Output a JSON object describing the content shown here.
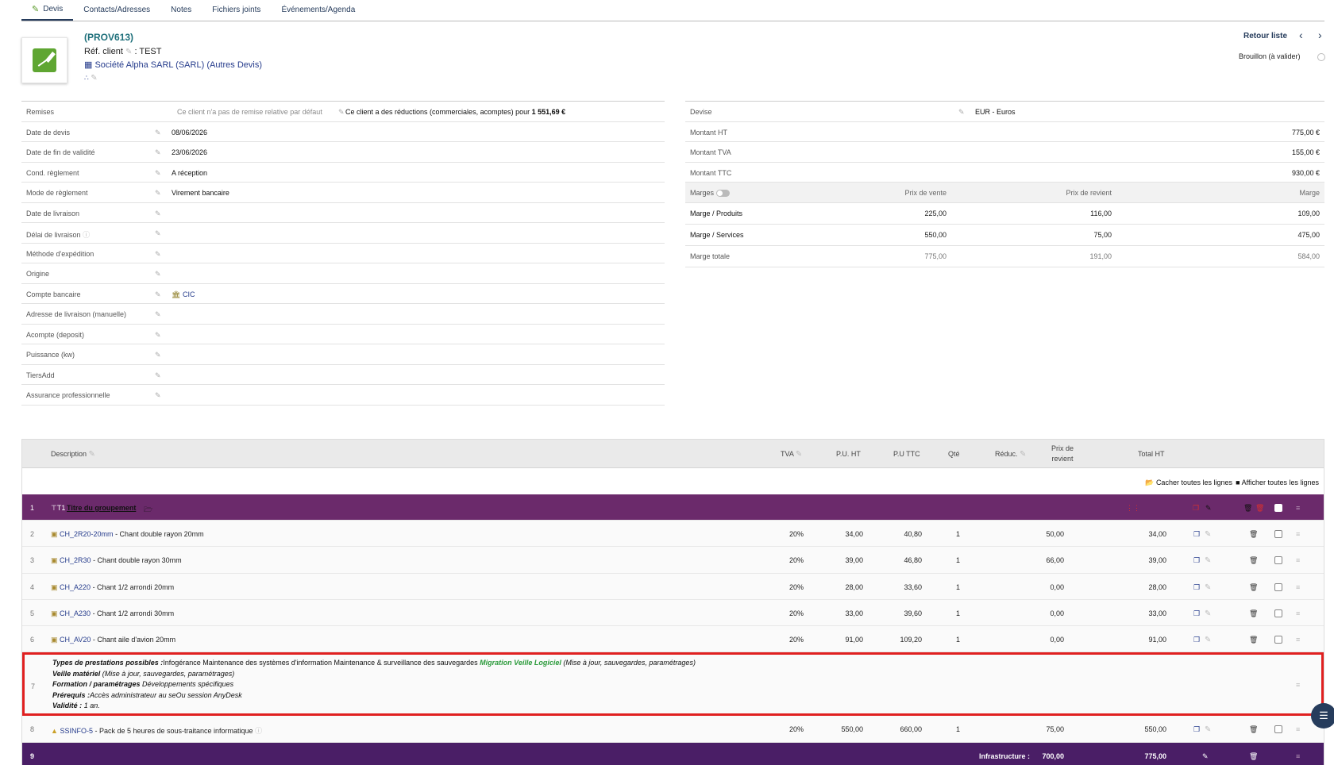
{
  "tabs": [
    {
      "label": "Devis",
      "active": true
    },
    {
      "label": "Contacts/Adresses"
    },
    {
      "label": "Notes"
    },
    {
      "label": "Fichiers joints"
    },
    {
      "label": "Événements/Agenda"
    }
  ],
  "header": {
    "ref": "(PROV613)",
    "ref_client_label": "Réf. client",
    "ref_client_value": ": TEST",
    "company": "Société Alpha SARL (SARL)",
    "other_quotes": "(Autres Devis)",
    "back_link": "Retour liste",
    "status": "Brouillon (à valider)"
  },
  "left_fields": [
    {
      "label": "Remises",
      "value": "Ce client n'a pas de remise relative par défaut",
      "value2": "Ce client a des réductions (commerciales, acomptes) pour",
      "value2_bold": "1 551,69 €"
    },
    {
      "label": "Date de devis",
      "value": "08/06/2026"
    },
    {
      "label": "Date de fin de validité",
      "value": "23/06/2026"
    },
    {
      "label": "Cond. règlement",
      "value": "A réception"
    },
    {
      "label": "Mode de règlement",
      "value": "Virement bancaire"
    },
    {
      "label": "Date de livraison",
      "value": ""
    },
    {
      "label": "Délai de livraison",
      "value": ""
    },
    {
      "label": "Méthode d'expédition",
      "value": ""
    },
    {
      "label": "Origine",
      "value": ""
    },
    {
      "label": "Compte bancaire",
      "value": "CIC"
    },
    {
      "label": "Adresse de livraison (manuelle)",
      "value": ""
    },
    {
      "label": "Acompte (deposit)",
      "value": ""
    },
    {
      "label": "Puissance (kw)",
      "value": ""
    },
    {
      "label": "TiersAdd",
      "value": ""
    },
    {
      "label": "Assurance professionnelle",
      "value": ""
    }
  ],
  "right_fields": {
    "devise_label": "Devise",
    "devise_value": "EUR - Euros",
    "ht_label": "Montant HT",
    "ht_value": "775,00 €",
    "tva_label": "Montant TVA",
    "tva_value": "155,00 €",
    "ttc_label": "Montant TTC",
    "ttc_value": "930,00 €",
    "marges_label": "Marges",
    "col_vente": "Prix de vente",
    "col_revient": "Prix de revient",
    "col_marge": "Marge",
    "margins": [
      {
        "label": "Marge / Produits",
        "vente": "225,00",
        "revient": "116,00",
        "marge": "109,00"
      },
      {
        "label": "Marge / Services",
        "vente": "550,00",
        "revient": "75,00",
        "marge": "475,00"
      },
      {
        "label": "Marge totale",
        "vente": "775,00",
        "revient": "191,00",
        "marge": "584,00"
      }
    ]
  },
  "lines_header": {
    "description": "Description",
    "tva": "TVA",
    "pu_ht": "P.U. HT",
    "pu_ttc": "P.U TTC",
    "qty": "Qté",
    "reduc": "Réduc.",
    "prix_revient_1": "Prix de",
    "prix_revient_2": "revient",
    "total_ht": "Total HT",
    "hide_all": "Cacher toutes les lignes",
    "show_all": "Afficher toutes les lignes"
  },
  "group_title": {
    "num": "1",
    "prefix": "T1",
    "label": "Titre du groupement"
  },
  "lines": [
    {
      "num": "2",
      "ref": "CH_2R20-20mm",
      "label": " - Chant double rayon 20mm",
      "tva": "20%",
      "pu_ht": "34,00",
      "pu_ttc": "40,80",
      "qty": "1",
      "revient": "50,00",
      "total": "34,00"
    },
    {
      "num": "3",
      "ref": "CH_2R30",
      "label": " - Chant double rayon 30mm",
      "tva": "20%",
      "pu_ht": "39,00",
      "pu_ttc": "46,80",
      "qty": "1",
      "revient": "66,00",
      "total": "39,00"
    },
    {
      "num": "4",
      "ref": "CH_A220",
      "label": " - Chant 1/2 arrondi 20mm",
      "tva": "20%",
      "pu_ht": "28,00",
      "pu_ttc": "33,60",
      "qty": "1",
      "revient": "0,00",
      "total": "28,00"
    },
    {
      "num": "5",
      "ref": "CH_A230",
      "label": " - Chant 1/2 arrondi 30mm",
      "tva": "20%",
      "pu_ht": "33,00",
      "pu_ttc": "39,60",
      "qty": "1",
      "revient": "0,00",
      "total": "33,00"
    },
    {
      "num": "6",
      "ref": "CH_AV20",
      "label": " - Chant aile d'avion 20mm",
      "tva": "20%",
      "pu_ht": "91,00",
      "pu_ttc": "109,20",
      "qty": "1",
      "revient": "0,00",
      "total": "91,00"
    }
  ],
  "desc_line": {
    "num": "7",
    "l1_bold": "Types de prestations possibles :",
    "l1_text": "Infogérance Maintenance des systèmes d'information Maintenance & surveillance des sauvegardes ",
    "l1_green": "Migration Veille Logiciel",
    "l1_tail": " (Mise à jour, sauvegardes, paramétrages)",
    "l2_bold": "Veille matériel",
    "l2_text": " (Mise à jour, sauvegardes, paramétrages)",
    "l3_bold": "Formation / paramétrages",
    "l3_text": " Développements spécifiques",
    "l4_bold": "Prérequis :",
    "l4_text": "Accès administrateur au seOu session AnyDesk",
    "l5_bold": "Validité : ",
    "l5_text": "1 an."
  },
  "service_line": {
    "num": "8",
    "ref": "SSINFO-5",
    "label": " - Pack de 5 heures de sous-traitance informatique",
    "tva": "20%",
    "pu_ht": "550,00",
    "pu_ttc": "660,00",
    "qty": "1",
    "revient": "75,00",
    "total": "550,00"
  },
  "subtotal_line": {
    "num": "9",
    "label": "Infrastructure :",
    "revient": "700,00",
    "total": "775,00"
  }
}
